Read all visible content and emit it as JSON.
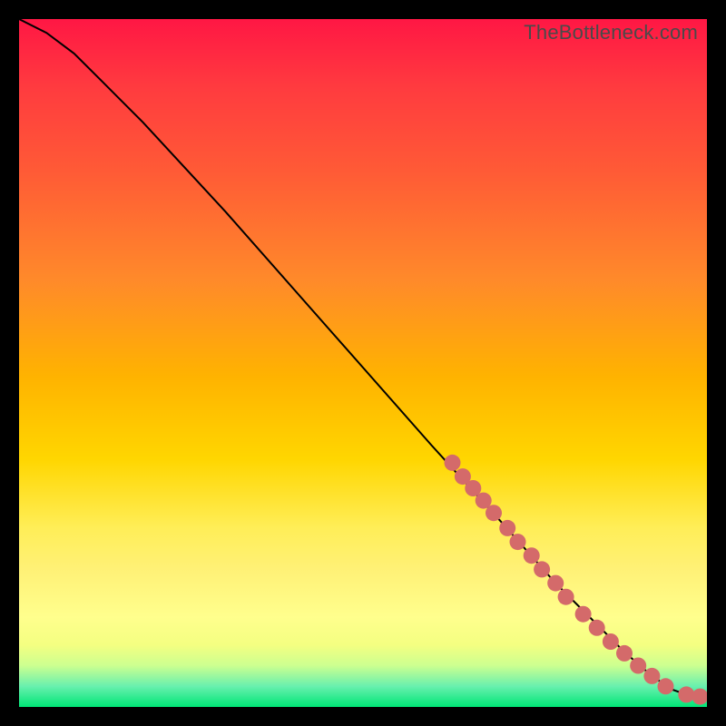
{
  "watermark": "TheBottleneck.com",
  "colors": {
    "marker": "#d46a6a",
    "curve": "#000000",
    "background_top": "#ff1744",
    "background_bottom": "#00e676"
  },
  "chart_data": {
    "type": "line",
    "title": "",
    "xlabel": "",
    "ylabel": "",
    "xlim": [
      0,
      100
    ],
    "ylim": [
      0,
      100
    ],
    "series": [
      {
        "name": "curve",
        "x": [
          0,
          4,
          8,
          12,
          18,
          30,
          45,
          60,
          70,
          78,
          84,
          88,
          92,
          95,
          97,
          100
        ],
        "y": [
          100,
          98,
          95,
          91,
          85,
          72,
          55,
          38,
          27,
          18,
          12,
          8,
          4.5,
          2.5,
          1.8,
          1.5
        ]
      }
    ],
    "markers": [
      {
        "x": 63.0,
        "y": 35.5
      },
      {
        "x": 64.5,
        "y": 33.5
      },
      {
        "x": 66.0,
        "y": 31.8
      },
      {
        "x": 67.5,
        "y": 30.0
      },
      {
        "x": 69.0,
        "y": 28.2
      },
      {
        "x": 71.0,
        "y": 26.0
      },
      {
        "x": 72.5,
        "y": 24.0
      },
      {
        "x": 74.5,
        "y": 22.0
      },
      {
        "x": 76.0,
        "y": 20.0
      },
      {
        "x": 78.0,
        "y": 18.0
      },
      {
        "x": 79.5,
        "y": 16.0
      },
      {
        "x": 82.0,
        "y": 13.5
      },
      {
        "x": 84.0,
        "y": 11.5
      },
      {
        "x": 86.0,
        "y": 9.5
      },
      {
        "x": 88.0,
        "y": 7.8
      },
      {
        "x": 90.0,
        "y": 6.0
      },
      {
        "x": 92.0,
        "y": 4.5
      },
      {
        "x": 94.0,
        "y": 3.0
      },
      {
        "x": 97.0,
        "y": 1.8
      },
      {
        "x": 99.0,
        "y": 1.5
      }
    ]
  }
}
